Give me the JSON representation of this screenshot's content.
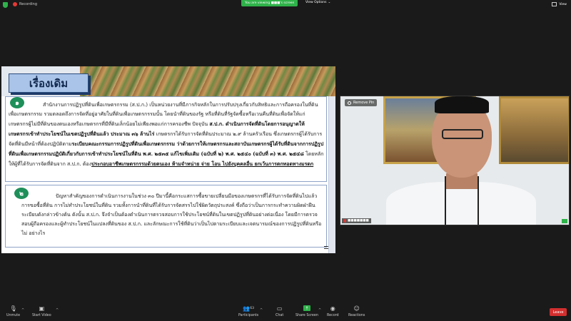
{
  "topbar": {
    "recording_label": "Recording",
    "viewing_label": "You are viewing ■■■'s screen",
    "view_options_label": "View Options",
    "view_label": "View"
  },
  "slide": {
    "title": "เรื่องเดิม",
    "badge1": "๑",
    "badge2": "๒",
    "p1": {
      "t1": "สำนักงานการปฏิรูปที่ดินเพื่อเกษตรกรรม (ส.ป.ก.) เป็นหน่วยงานที่มีภารกิจหลักในการปรับปรุงเกี่ยวกับสิทธิและการถือครองในที่ดินเพื่อเกษตรกรรม รวมตลอดถึงการจัดที่อยู่อาศัยในที่ดินเพื่อเกษตรกรรมนั้น โดยนำที่ดินของรัฐ หรือที่ดินที่รัฐจัดซื้อหรือเวนคืนที่ดินเพื่อจัดให้แก่เกษตรกรผู้ไม่มีที่ดินของตนเองหรือเกษตรกรที่มีที่ดินเล็กน้อยไม่เพียงพอแก่การครองชีพ ปัจจุบัน",
      "b1": "ส.ป.ก. ดำเนินการจัดที่ดินโดยการอนุญาตให้เกษตรกรเข้าทำประโยชน์ในเขตปฏิรูปที่ดินแล้ว ประมาณ ๓๖ ล้านไร่",
      "t2": "เกษตรกรได้รับการจัดที่ดินประมาณ ๒.๙ ล้านครัวเรือน ซึ่งเกษตรกรผู้ได้รับการจัดที่ดินมีหน้าที่ต้องปฏิบัติตาม",
      "b2": "ระเบียบคณะกรรมการปฏิรูปที่ดินเพื่อเกษตรกรรม ว่าด้วยการให้เกษตรกรและสถาบันเกษตรกรผู้ได้รับที่ดินจากการปฏิรูปที่ดินเพื่อเกษตรกรรมปฏิบัติเกี่ยวกับการเข้าทำประโยชน์ในที่ดิน พ.ศ. ๒๕๓๕ แก้ไขเพิ่มเติม (ฉบับที่ ๒) พ.ศ. ๒๕๔๐ (ฉบับที่ ๓) พ.ศ. ๒๕๔๘",
      "t3": "โดยหลักให้ผู้ที่ได้รับการจัดที่ดินจาก ส.ป.ก. ต้อง",
      "b3": "ประกอบอาชีพเกษตรกรรมด้วยตนเอง ห้ามจำหน่าย จ่าย โอน ไปยังบุคคลอื่น ยกเว้นการตกทอดทางมรดก"
    },
    "p2": "ปัญหาสำคัญของการดำเนินการงานในช่วง ๓๐ ปีมานี้คือกระแสการซื้อขายเปลี่ยนมือของเกษตรกรที่ได้รับการจัดที่ดินไปแล้ว การขอซื้อที่ดิน การไม่ทำประโยชน์ในที่ดิน รวมทั้งการนำที่ดินที่ได้รับการจัดสรรไปใช้ผิดวัตถุประสงค์ ซึ่งถือว่าเป็นการกระทำความผิดฝ่าฝืนระเบียบดังกล่าวข้างต้น ดังนั้น ส.ป.ก. จึงจำเป็นต้องดำเนินการตรวจสอบการใช้ประโยชน์ที่ดินในเขตปฏิรูปที่ดินอย่างต่อเนื่อง โดยมีการตรวจสอบผู้ถือครองและผู้ทำประโยชน์ในแปลงที่ดินของ ส.ป.ก. และลักษณะการใช้ที่ดินว่าเป็นไปตามระเบียบและเจตนารมณ์ของการปฏิรูปที่ดินหรือไม่ อย่างไร"
  },
  "video": {
    "remove_pin_label": "Remove Pin",
    "name_label": "■■■■■■■"
  },
  "toolbar": {
    "unmute": "Unmute",
    "start_video": "Start Video",
    "participants": "Participants",
    "participants_count": "63",
    "chat": "Chat",
    "share_screen": "Share Screen",
    "record": "Record",
    "reactions": "Reactions",
    "leave": "Leave"
  },
  "colors": {
    "accent_green": "#2fb24a",
    "leave_red": "#d32f2f",
    "slide_badge": "#1f8f5a"
  }
}
